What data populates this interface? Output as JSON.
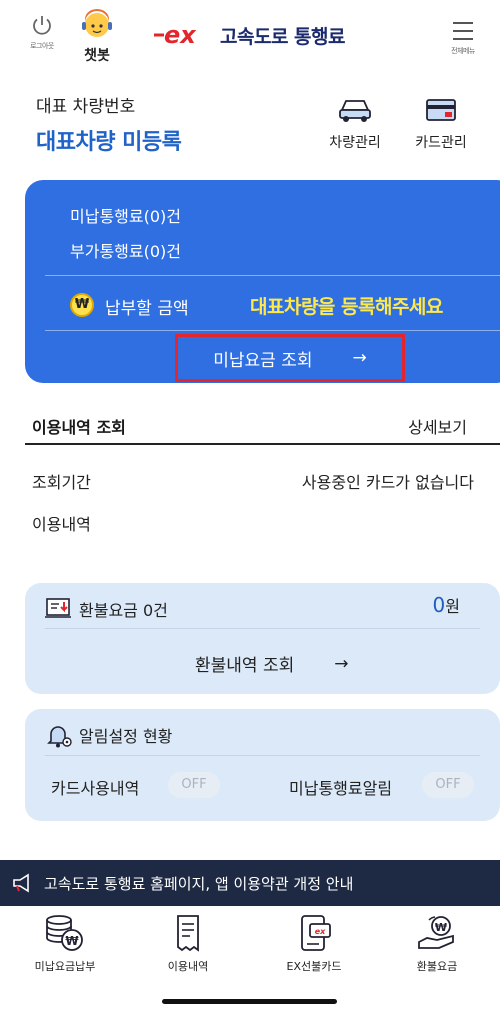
{
  "header": {
    "logout_label": "로그아웃",
    "chatbot_label": "챗봇",
    "brand_logo": "ex",
    "app_title": "고속도로 통행료",
    "menu_label": "전체메뉴"
  },
  "vehicle": {
    "label": "대표 차량번호",
    "value": "대표차량 미등록",
    "vehicle_mgmt": "차량관리",
    "card_mgmt": "카드관리"
  },
  "summary": {
    "unpaid_toll": "미납통행료(0)건",
    "extra_toll": "부가통행료(0)건",
    "pay_label": "납부할 금액",
    "pay_message": "대표차량을 등록해주세요",
    "unpaid_lookup": "미납요금 조회",
    "arrow": "→",
    "coin_symbol": "₩"
  },
  "usage": {
    "title": "이용내역 조회",
    "detail_link": "상세보기",
    "period_label": "조회기간",
    "period_value": "사용중인 카드가 없습니다",
    "history_label": "이용내역"
  },
  "refund": {
    "label": "환불요금 0건",
    "amount": "0",
    "unit": "원",
    "lookup": "환불내역 조회",
    "arrow": "→"
  },
  "alerts": {
    "title": "알림설정 현황",
    "card_usage": "카드사용내역",
    "card_usage_state": "OFF",
    "unpaid_alert": "미납통행료알림",
    "unpaid_alert_state": "OFF"
  },
  "notice": {
    "text": "고속도로 통행료 홈페이지, 앱 이용약관 개정 안내"
  },
  "nav": {
    "items": [
      {
        "label": "미납요금납부",
        "icon": "coin-stack-icon"
      },
      {
        "label": "이용내역",
        "icon": "receipt-icon"
      },
      {
        "label": "EX선불카드",
        "icon": "prepaid-card-icon"
      },
      {
        "label": "환불요금",
        "icon": "refund-hand-icon"
      }
    ]
  },
  "colors": {
    "accent_blue": "#2f6fe1",
    "title_blue": "#1f63c9",
    "highlight_yellow": "#ffe94a",
    "brand_red": "#e3262e",
    "panel_bg": "#dce9f8",
    "notice_bg": "#1e2a44"
  }
}
